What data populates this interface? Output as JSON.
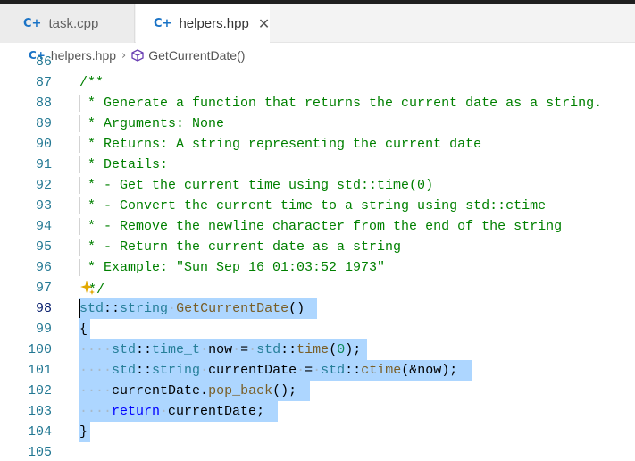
{
  "tabs": [
    {
      "label": "task.cpp",
      "active": false
    },
    {
      "label": "helpers.hpp",
      "active": true
    }
  ],
  "breadcrumb": {
    "file": "helpers.hpp",
    "symbol": "GetCurrentDate()"
  },
  "icons": {
    "file": "c-plus-plus-file-icon",
    "symbol": "cube-symbol-icon",
    "close": "close-icon",
    "ai": "sparkle-icon"
  },
  "colors": {
    "comment": "#008000",
    "keyword": "#0000ff",
    "type": "#267f99",
    "function": "#795e26",
    "number": "#098658",
    "selection": "#add6ff",
    "line_number": "#237893"
  },
  "editor": {
    "line_numbers": [
      "86",
      "87",
      "88",
      "89",
      "90",
      "91",
      "92",
      "93",
      "94",
      "95",
      "96",
      "97",
      "98",
      "99",
      "100",
      "101",
      "102",
      "103",
      "104",
      "105"
    ],
    "comment_lines": [
      "/**",
      " * Generate a function that returns the current date as a string.",
      " * Arguments: None",
      " * Returns: A string representing the current date",
      " * Details:",
      " * - Get the current time using std::time(0)",
      " * - Convert the current time to a string using std::ctime",
      " * - Remove the newline character from the end of the string",
      " * - Return the current date as a string",
      " * Example: \"Sun Sep 16 01:03:52 1973\"",
      "*/"
    ],
    "code": {
      "ns": "std",
      "sep": "::",
      "string_type": "string",
      "func_name": "GetCurrentDate",
      "parens": "()",
      "open_brace": "{",
      "close_brace": "}",
      "time_t_type": "time_t",
      "var_now": "now",
      "eq": "=",
      "time_fn": "time",
      "zero": "0",
      "close_paren_semi": ");",
      "open_paren": "(",
      "var_current_date": "currentDate",
      "ctime_fn": "ctime",
      "amp_now": "&now",
      "dot": ".",
      "pop_back": "pop_back",
      "paren_semi": "();",
      "return_kw": "return",
      "semi": ";",
      "indent_dots": "····"
    },
    "current_line": "98"
  }
}
